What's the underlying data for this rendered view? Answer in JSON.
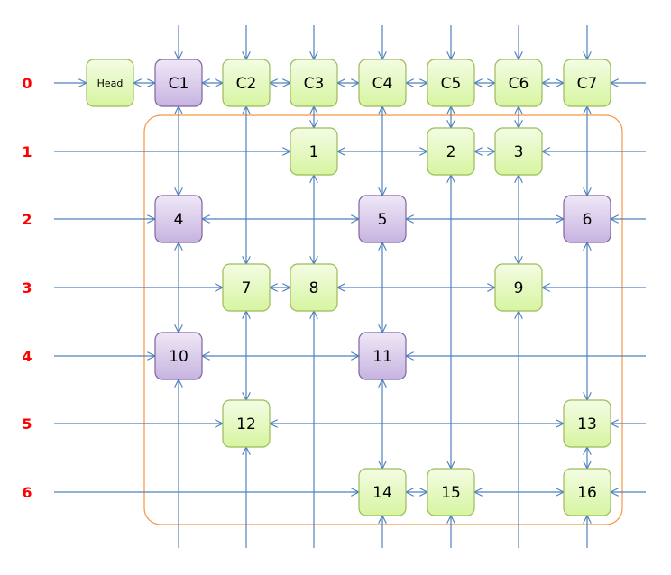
{
  "head": {
    "label": "Head"
  },
  "columns": [
    {
      "label": "C1",
      "type": "purple"
    },
    {
      "label": "C2",
      "type": "green"
    },
    {
      "label": "C3",
      "type": "green"
    },
    {
      "label": "C4",
      "type": "green"
    },
    {
      "label": "C5",
      "type": "green"
    },
    {
      "label": "C6",
      "type": "green"
    },
    {
      "label": "C7",
      "type": "green"
    }
  ],
  "row_labels": [
    "0",
    "1",
    "2",
    "3",
    "4",
    "5",
    "6"
  ],
  "nodes": [
    {
      "label": "1",
      "row": 1,
      "col": 3,
      "type": "green"
    },
    {
      "label": "2",
      "row": 1,
      "col": 5,
      "type": "green"
    },
    {
      "label": "3",
      "row": 1,
      "col": 6,
      "type": "green"
    },
    {
      "label": "4",
      "row": 2,
      "col": 1,
      "type": "purple"
    },
    {
      "label": "5",
      "row": 2,
      "col": 4,
      "type": "purple"
    },
    {
      "label": "6",
      "row": 2,
      "col": 7,
      "type": "purple"
    },
    {
      "label": "7",
      "row": 3,
      "col": 2,
      "type": "green"
    },
    {
      "label": "8",
      "row": 3,
      "col": 3,
      "type": "green"
    },
    {
      "label": "9",
      "row": 3,
      "col": 6,
      "type": "green"
    },
    {
      "label": "10",
      "row": 4,
      "col": 1,
      "type": "purple"
    },
    {
      "label": "11",
      "row": 4,
      "col": 4,
      "type": "purple"
    },
    {
      "label": "12",
      "row": 5,
      "col": 2,
      "type": "green"
    },
    {
      "label": "13",
      "row": 5,
      "col": 7,
      "type": "green"
    },
    {
      "label": "14",
      "row": 6,
      "col": 4,
      "type": "green"
    },
    {
      "label": "15",
      "row": 6,
      "col": 5,
      "type": "green"
    },
    {
      "label": "16",
      "row": 6,
      "col": 7,
      "type": "green"
    }
  ],
  "colors": {
    "link": "#4f81bd",
    "row_label": "#ff0000",
    "group_outline": "#f79646",
    "green_fill_top": "#f4fce4",
    "green_fill_bottom": "#d6f5a0",
    "green_border": "#9bbb59",
    "purple_fill_top": "#efe8f7",
    "purple_fill_bottom": "#c7b3e0",
    "purple_border": "#8064a2"
  }
}
